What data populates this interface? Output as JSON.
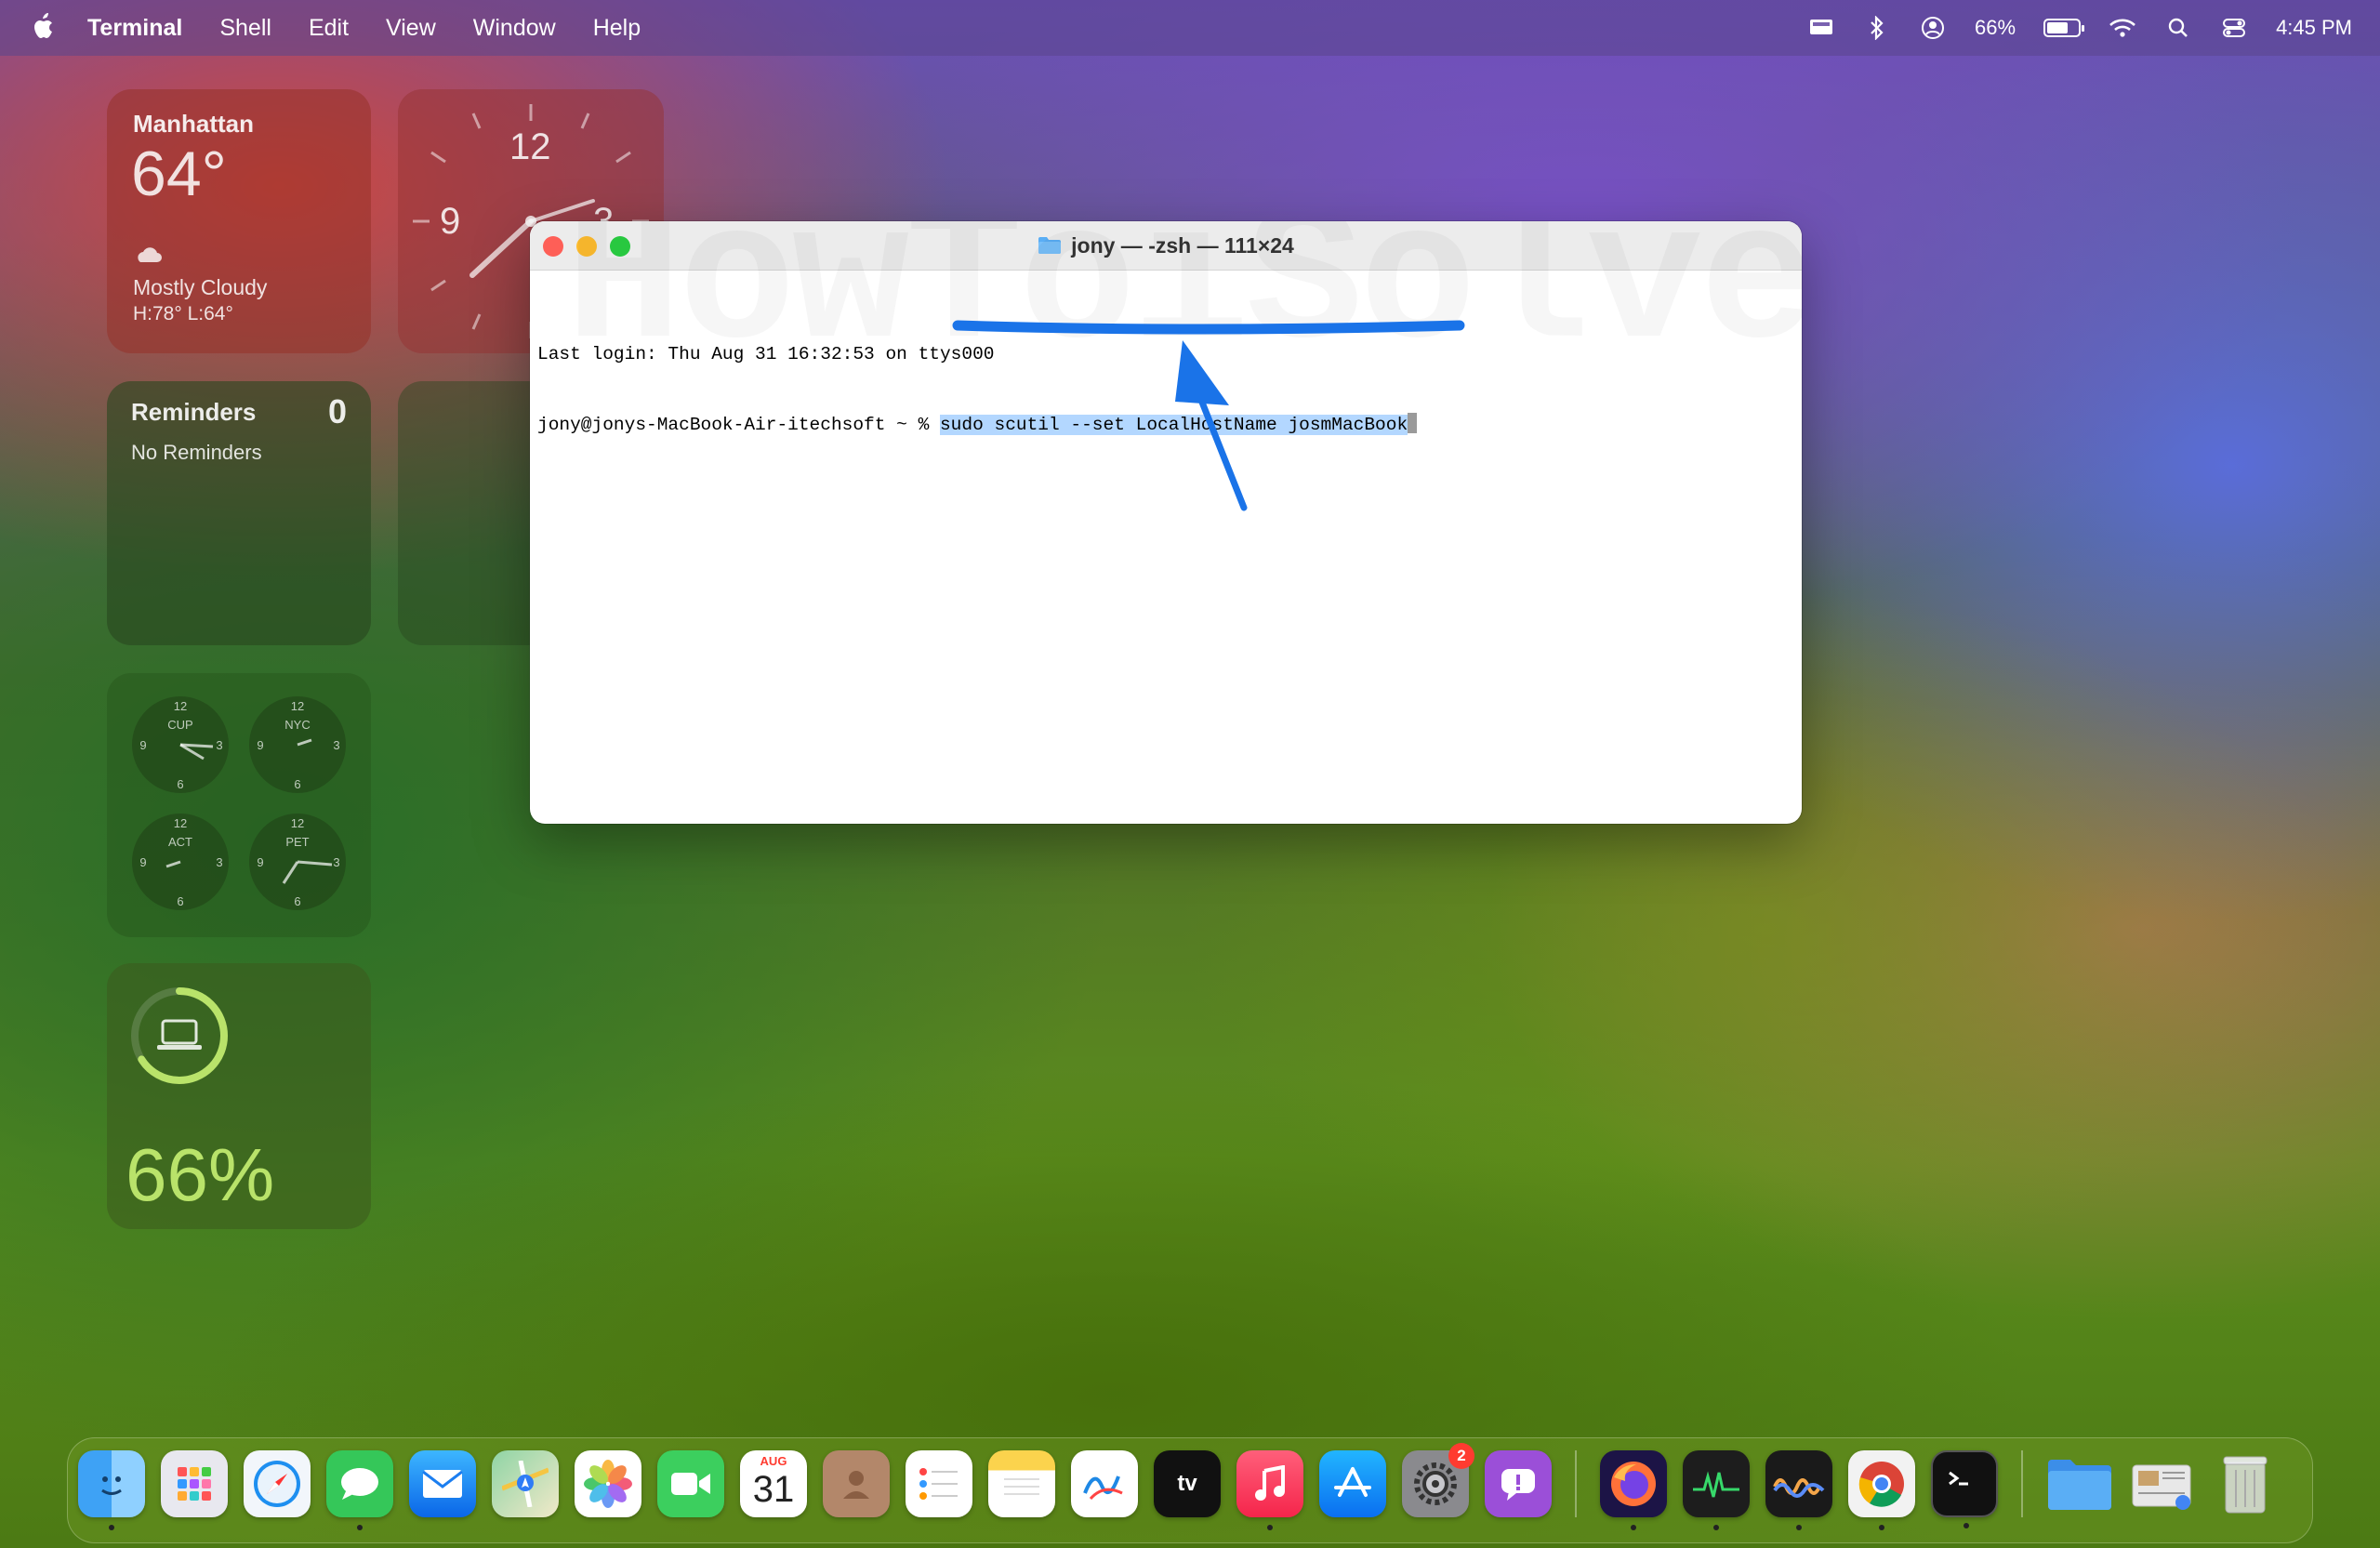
{
  "menubar": {
    "app_name": "Terminal",
    "menus": [
      "Shell",
      "Edit",
      "View",
      "Window",
      "Help"
    ],
    "battery_percent": "66%",
    "clock": "4:45 PM"
  },
  "widgets": {
    "weather": {
      "city": "Manhattan",
      "temp": "64°",
      "condition": "Mostly Cloudy",
      "high_low": "H:78° L:64°"
    },
    "clock": {
      "n12": "12",
      "n9": "9",
      "n3": "3"
    },
    "reminders": {
      "title": "Reminders",
      "count": "0",
      "empty": "No Reminders"
    },
    "world_clock": [
      "CUP",
      "NYC",
      "ACT",
      "PET"
    ],
    "battery": {
      "percent": "66%",
      "level": 0.66
    }
  },
  "terminal": {
    "title": "jony — -zsh — 111×24",
    "line1": "Last login: Thu Aug 31 16:32:53 on ttys000",
    "prompt": "jony@jonys-MacBook-Air-itechsoft ~ % ",
    "command": "sudo scutil --set LocalHostName josmMacBook",
    "watermark": "HowToiSolve.com"
  },
  "dock": {
    "apps": [
      {
        "name": "Finder",
        "icon": "finder-icon",
        "running": true
      },
      {
        "name": "Launchpad",
        "icon": "launchpad-icon",
        "running": false
      },
      {
        "name": "Safari",
        "icon": "safari-icon",
        "running": false
      },
      {
        "name": "Messages",
        "icon": "messages-icon",
        "running": true
      },
      {
        "name": "Mail",
        "icon": "mail-icon",
        "running": false
      },
      {
        "name": "Maps",
        "icon": "maps-icon",
        "running": false
      },
      {
        "name": "Photos",
        "icon": "photos-icon",
        "running": false
      },
      {
        "name": "FaceTime",
        "icon": "facetime-icon",
        "running": false
      },
      {
        "name": "Calendar",
        "icon": "calendar-icon",
        "month": "AUG",
        "day": "31",
        "running": false
      },
      {
        "name": "Contacts",
        "icon": "contacts-icon",
        "running": false
      },
      {
        "name": "Reminders",
        "icon": "reminders-icon",
        "running": false
      },
      {
        "name": "Notes",
        "icon": "notes-icon",
        "running": false
      },
      {
        "name": "Freeform",
        "icon": "freeform-icon",
        "running": false
      },
      {
        "name": "TV",
        "icon": "appletv-icon",
        "label": "tv",
        "running": false
      },
      {
        "name": "Music",
        "icon": "music-icon",
        "running": true
      },
      {
        "name": "App Store",
        "icon": "appstore-icon",
        "running": false
      },
      {
        "name": "System Settings",
        "icon": "settings-icon",
        "badge": "2",
        "running": false
      },
      {
        "name": "Feedback",
        "icon": "feedback-icon",
        "running": false
      },
      {
        "name": "Firefox",
        "icon": "firefox-icon",
        "running": true
      },
      {
        "name": "Activity Monitor",
        "icon": "activity-monitor-icon",
        "running": true
      },
      {
        "name": "Voice Memos",
        "icon": "voice-icon",
        "running": true
      },
      {
        "name": "Chrome",
        "icon": "chrome-icon",
        "running": true
      },
      {
        "name": "Terminal",
        "icon": "terminal-icon",
        "running": true
      },
      {
        "name": "Downloads",
        "icon": "folder-icon",
        "running": false
      },
      {
        "name": "Preview",
        "icon": "preview-icon",
        "running": false
      },
      {
        "name": "Trash",
        "icon": "trash-icon",
        "running": false
      }
    ]
  },
  "colors": {
    "selection": "#b3d7ff",
    "annotation": "#1a73e8",
    "close": "#fe5f57",
    "minimize": "#febc2e",
    "zoom": "#28c840"
  }
}
